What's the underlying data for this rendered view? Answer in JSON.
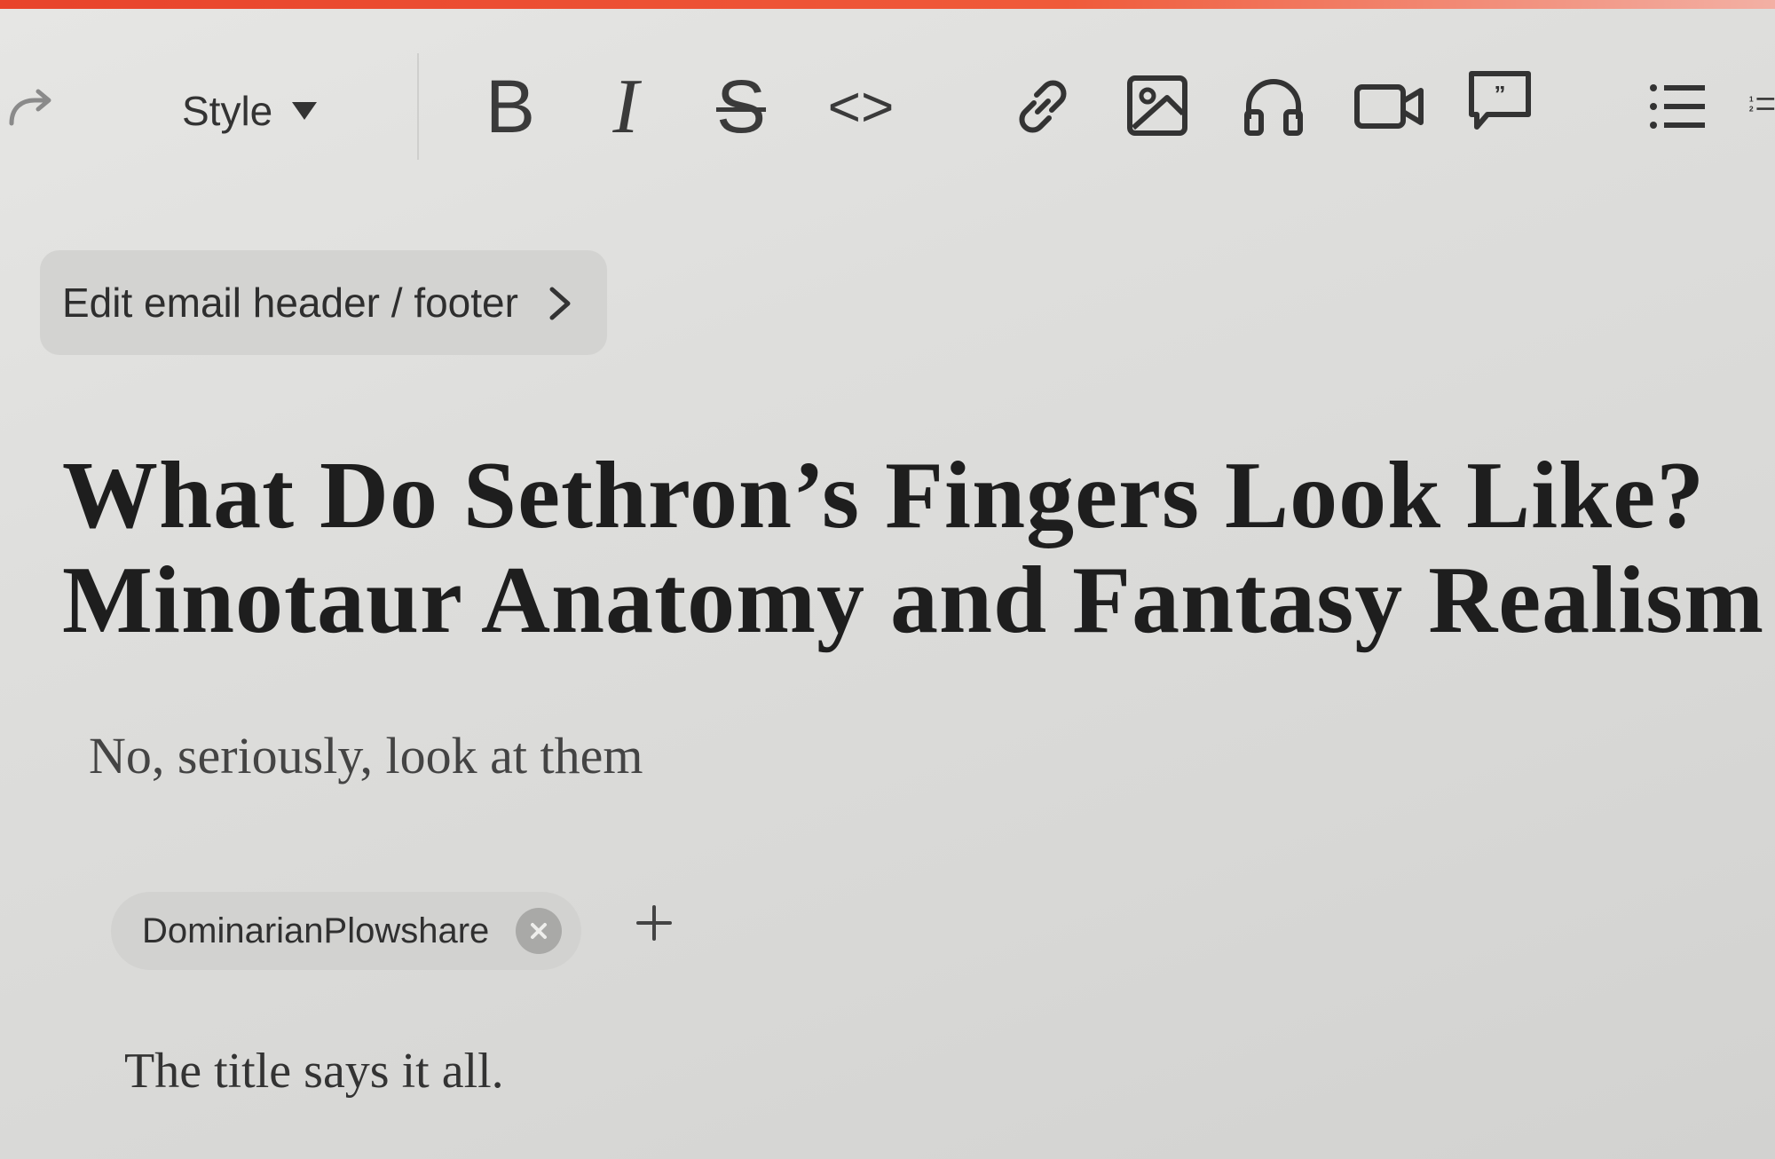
{
  "app": {
    "accent_color": "#e8432b"
  },
  "toolbar": {
    "redo_icon": "redo-icon",
    "style_label": "Style",
    "bold_label": "B",
    "italic_label": "I",
    "strike_label": "S",
    "code_label": "<>",
    "icons": [
      "link-icon",
      "image-icon",
      "audio-icon",
      "video-icon",
      "quote-icon",
      "bulleted-list-icon",
      "numbered-list-icon"
    ]
  },
  "email_settings": {
    "label": "Edit email header / footer"
  },
  "post": {
    "title_line1": "What Do Sethron’s Fingers Look Like?",
    "title_line2": "Minotaur Anatomy and Fantasy Realism",
    "subtitle": "No, seriously, look at them",
    "author": "DominarianPlowshare",
    "add_author_label": "+",
    "body": "The title says it all."
  }
}
